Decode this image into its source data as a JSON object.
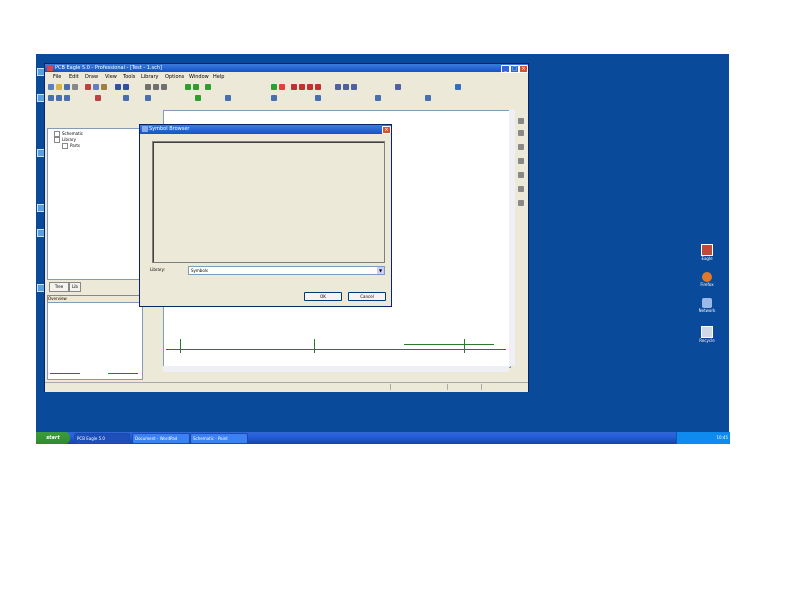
{
  "window": {
    "title": "PCB Eagle 5.0 - Professional - [Test - 1.sch]",
    "min": "_",
    "max": "□",
    "close": "×"
  },
  "menubar": [
    "File",
    "Edit",
    "Draw",
    "View",
    "Tools",
    "Library",
    "Options",
    "Window",
    "Help"
  ],
  "side_panel": {
    "tree": [
      "Schematic",
      "Library",
      "Parts"
    ],
    "tabs": [
      "Tree",
      "Lib"
    ],
    "overview_label": "Overview"
  },
  "statusbar": [
    "",
    "",
    ""
  ],
  "dialog": {
    "title": "Symbol Browser",
    "close": "×",
    "field_label": "Library:",
    "select_value": "Symbols",
    "ok_label": "OK",
    "cancel_label": "Cancel"
  },
  "desktop_icons": [
    "Eagle",
    "Firefox",
    "Network",
    "Recycle"
  ],
  "taskbar": {
    "start": "start",
    "buttons": [
      "PCB Eagle 5.0",
      "Document - WordPad",
      "Schematic - Paint"
    ],
    "clock": "10:45"
  },
  "colors": {
    "desktop": "#0a4a9a",
    "title_bar": "#1553c9",
    "taskbar": "#245edb",
    "start": "#2f8a2f"
  }
}
